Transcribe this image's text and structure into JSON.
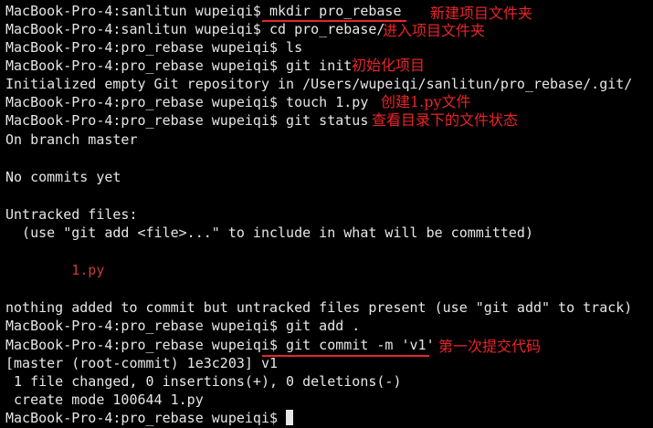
{
  "terminal": {
    "lines": [
      "MacBook-Pro-4:sanlitun wupeiqi$ mkdir pro_rebase",
      "MacBook-Pro-4:sanlitun wupeiqi$ cd pro_rebase/",
      "MacBook-Pro-4:pro_rebase wupeiqi$ ls",
      "MacBook-Pro-4:pro_rebase wupeiqi$ git init",
      "Initialized empty Git repository in /Users/wupeiqi/sanlitun/pro_rebase/.git/",
      "MacBook-Pro-4:pro_rebase wupeiqi$ touch 1.py",
      "MacBook-Pro-4:pro_rebase wupeiqi$ git status",
      "On branch master",
      "",
      "No commits yet",
      "",
      "Untracked files:",
      "  (use \"git add <file>...\" to include in what will be committed)",
      "",
      "        1.py",
      "",
      "nothing added to commit but untracked files present (use \"git add\" to track)",
      "MacBook-Pro-4:pro_rebase wupeiqi$ git add .",
      "MacBook-Pro-4:pro_rebase wupeiqi$ git commit -m 'v1'",
      "[master (root-commit) 1e3c203] v1",
      " 1 file changed, 0 insertions(+), 0 deletions(-)",
      " create mode 100644 1.py",
      "MacBook-Pro-4:pro_rebase wupeiqi$ "
    ]
  },
  "annotations": {
    "mkdir": "新建项目文件夹",
    "cd": "进入项目文件夹",
    "git_init": "初始化项目",
    "touch": "创建1.py文件",
    "git_status": "查看目录下的文件状态",
    "git_commit": "第一次提交代码"
  },
  "colors": {
    "background": "#000000",
    "text": "#e6e6e6",
    "annotation": "#e8242a",
    "untracked_file": "#c43b3b"
  }
}
